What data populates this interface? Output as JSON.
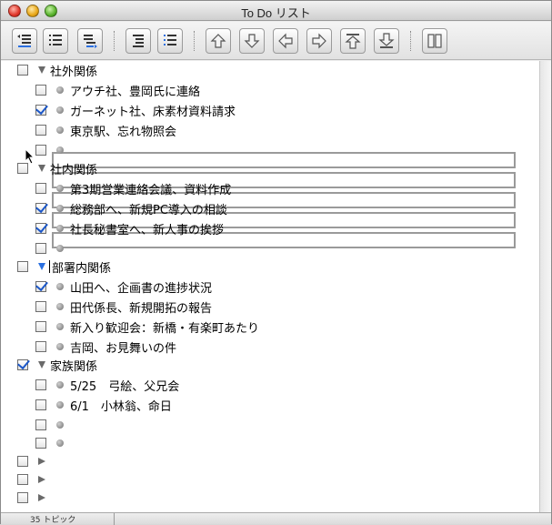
{
  "window": {
    "title": "To Do リスト"
  },
  "toolbar": {
    "buttons": [
      "outdent-left-icon",
      "list-icon",
      "indent-right-icon",
      "expand-all-icon",
      "collapse-all-icon",
      "arrow-up-icon",
      "arrow-down-icon",
      "arrow-left-icon",
      "arrow-right-icon",
      "move-to-top-icon",
      "move-to-bottom-icon",
      "columns-icon"
    ]
  },
  "rows": [
    {
      "type": "group",
      "label": "社外関係",
      "checked": false,
      "expanded": true
    },
    {
      "type": "item",
      "label": "アウチ社、豊岡氏に連絡",
      "checked": false
    },
    {
      "type": "item",
      "label": "ガーネット社、床素材資料請求",
      "checked": true
    },
    {
      "type": "item",
      "label": "東京駅、忘れ物照会",
      "checked": false
    },
    {
      "type": "item",
      "label": "",
      "checked": false
    },
    {
      "type": "group",
      "label": "社内関係",
      "checked": false,
      "expanded": true
    },
    {
      "type": "item",
      "label": "第3期営業連絡会議、資料作成",
      "checked": false
    },
    {
      "type": "item",
      "label": "総務部へ、新規PC導入の相談",
      "checked": true
    },
    {
      "type": "item",
      "label": "社長秘書室へ、新人事の挨拶",
      "checked": true
    },
    {
      "type": "item",
      "label": "",
      "checked": false
    },
    {
      "type": "group",
      "label": "部署内関係",
      "checked": false,
      "expanded": true,
      "selected": true
    },
    {
      "type": "item",
      "label": "山田へ、企画書の進捗状況",
      "checked": true
    },
    {
      "type": "item",
      "label": "田代係長、新規開拓の報告",
      "checked": false
    },
    {
      "type": "item",
      "label": "新入り歓迎会：新橋・有楽町あたり",
      "checked": false
    },
    {
      "type": "item",
      "label": "吉岡、お見舞いの件",
      "checked": false
    },
    {
      "type": "group",
      "label": "家族関係",
      "checked": true,
      "expanded": true
    },
    {
      "type": "item",
      "label": "5/25　弓絵、父兄会",
      "checked": false
    },
    {
      "type": "item",
      "label": "6/1　小林翁、命日",
      "checked": false
    },
    {
      "type": "item",
      "label": "",
      "checked": false
    },
    {
      "type": "item",
      "label": "",
      "checked": false
    },
    {
      "type": "collapsed",
      "label": "",
      "checked": false
    },
    {
      "type": "collapsed",
      "label": "",
      "checked": false
    },
    {
      "type": "collapsed",
      "label": "",
      "checked": false
    }
  ],
  "status": {
    "topics": "35 トピック"
  },
  "colors": {
    "check": "#1a56c8",
    "selected_triangle": "#2a6fe0"
  }
}
